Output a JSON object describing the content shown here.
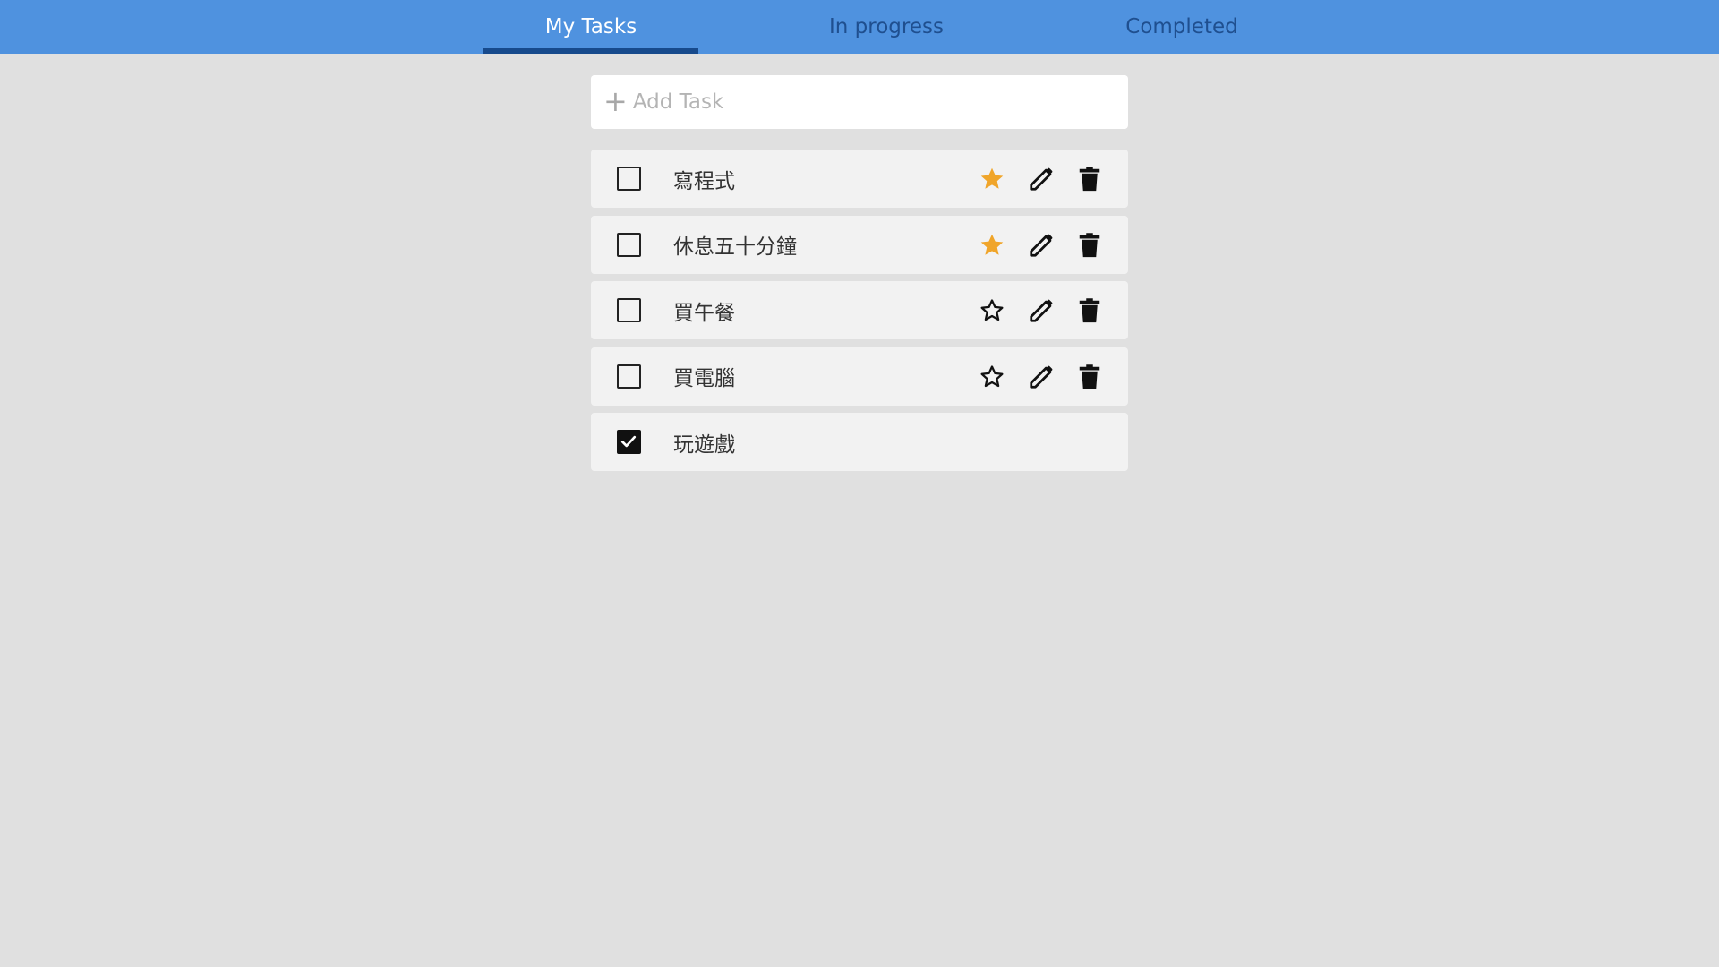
{
  "colors": {
    "navbar_bg": "#4f92df",
    "tab_text": "#1f4f8f",
    "tab_active_text": "#ffffff",
    "tab_underline": "#174a8c",
    "page_bg": "#e0e0e0",
    "task_bg": "#f2f2f2",
    "star_active": "#f0a52a"
  },
  "nav": {
    "tabs": [
      {
        "label": "My Tasks",
        "active": true
      },
      {
        "label": "In progress",
        "active": false
      },
      {
        "label": "Completed",
        "active": false
      }
    ]
  },
  "add_task": {
    "placeholder": "Add Task",
    "value": "",
    "icon": "plus-icon"
  },
  "tasks": [
    {
      "title": "寫程式",
      "completed": false,
      "starred": true
    },
    {
      "title": "休息五十分鐘",
      "completed": false,
      "starred": true
    },
    {
      "title": "買午餐",
      "completed": false,
      "starred": false
    },
    {
      "title": "買電腦",
      "completed": false,
      "starred": false
    },
    {
      "title": "玩遊戲",
      "completed": true,
      "starred": false
    }
  ],
  "icons": {
    "star": "star-icon",
    "edit": "pencil-icon",
    "delete": "trash-icon",
    "check": "checkmark-icon"
  }
}
